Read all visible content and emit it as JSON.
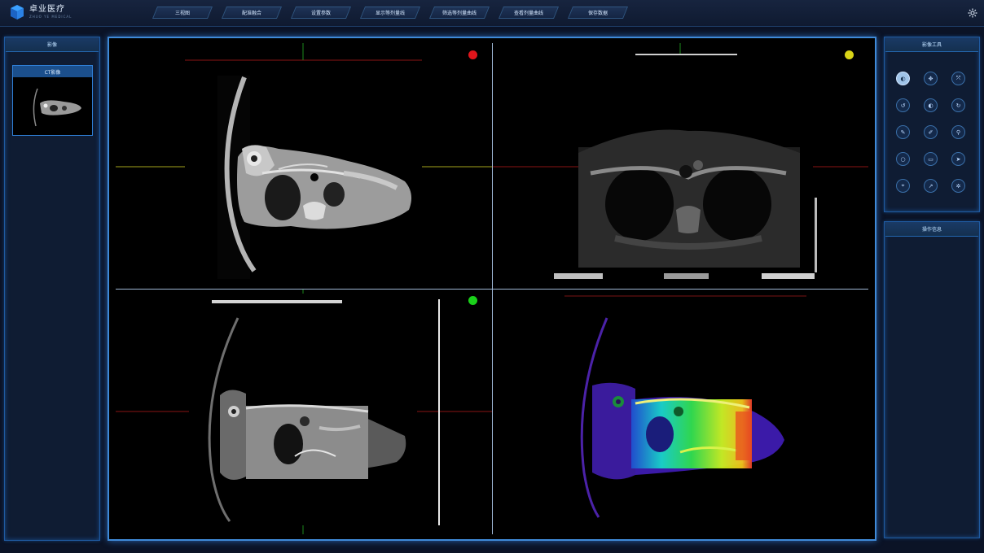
{
  "header": {
    "logo_cn": "卓业医疗",
    "logo_en": "ZHUO YE MEDICAL",
    "nav": [
      "三视图",
      "配准融合",
      "设置参数",
      "显示等剂量线",
      "筛选等剂量曲线",
      "查看剂量曲线",
      "保存数据"
    ],
    "settings_icon": "gear-icon"
  },
  "left_panel": {
    "title": "影像",
    "thumbnail_title": "CT影像"
  },
  "viewports": [
    {
      "name": "ct-axial",
      "marker_color": "#e0151b"
    },
    {
      "name": "mr-axial",
      "marker_color": "#d9d417"
    },
    {
      "name": "fusion-overlay",
      "marker_color": "#1ad11a"
    },
    {
      "name": "dose-colormap",
      "marker_color": ""
    }
  ],
  "tools_panel": {
    "title": "影像工具",
    "tools": [
      {
        "name": "window-level-icon",
        "glyph": "◐",
        "active": true
      },
      {
        "name": "pan-icon",
        "glyph": "✥",
        "active": false
      },
      {
        "name": "zoom-icon",
        "glyph": "⤧",
        "active": false
      },
      {
        "name": "rotate-left-icon",
        "glyph": "↺",
        "active": false
      },
      {
        "name": "contrast-icon",
        "glyph": "◐",
        "active": false
      },
      {
        "name": "rotate-right-icon",
        "glyph": "↻",
        "active": false
      },
      {
        "name": "pencil-icon",
        "glyph": "✎",
        "active": false
      },
      {
        "name": "brush-icon",
        "glyph": "✐",
        "active": false
      },
      {
        "name": "pin-icon",
        "glyph": "⚲",
        "active": false
      },
      {
        "name": "circle-roi-icon",
        "glyph": "○",
        "active": false
      },
      {
        "name": "rect-roi-icon",
        "glyph": "▭",
        "active": false
      },
      {
        "name": "cursor-icon",
        "glyph": "➤",
        "active": false
      },
      {
        "name": "crosshair-icon",
        "glyph": "⌖",
        "active": false
      },
      {
        "name": "arrow-icon",
        "glyph": "↗",
        "active": false
      },
      {
        "name": "settings-icon",
        "glyph": "✲",
        "active": false
      }
    ]
  },
  "info_panel": {
    "title": "操作信息"
  }
}
